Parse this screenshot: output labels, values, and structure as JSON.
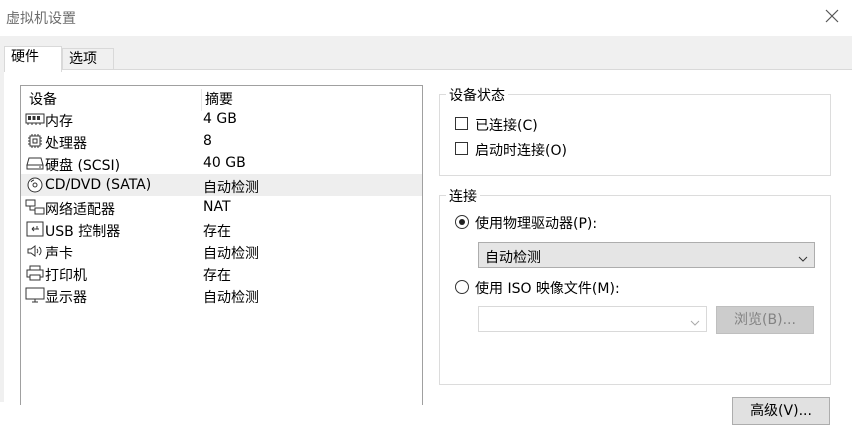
{
  "window": {
    "title": "虚拟机设置",
    "close_icon": "close-icon"
  },
  "tabs": [
    {
      "label": "硬件",
      "active": true
    },
    {
      "label": "选项",
      "active": false
    }
  ],
  "hardware_list": {
    "headers": {
      "device": "设备",
      "summary": "摘要"
    },
    "items": [
      {
        "name": "内存",
        "summary": "4 GB",
        "icon": "memory-icon",
        "selected": false
      },
      {
        "name": "处理器",
        "summary": "8",
        "icon": "processor-icon",
        "selected": false
      },
      {
        "name": "硬盘 (SCSI)",
        "summary": "40 GB",
        "icon": "hard-disk-icon",
        "selected": false
      },
      {
        "name": "CD/DVD (SATA)",
        "summary": "自动检测",
        "icon": "cd-dvd-icon",
        "selected": true
      },
      {
        "name": "网络适配器",
        "summary": "NAT",
        "icon": "network-adapter-icon",
        "selected": false
      },
      {
        "name": "USB 控制器",
        "summary": "存在",
        "icon": "usb-icon",
        "selected": false
      },
      {
        "name": "声卡",
        "summary": "自动检测",
        "icon": "speaker-icon",
        "selected": false
      },
      {
        "name": "打印机",
        "summary": "存在",
        "icon": "printer-icon",
        "selected": false
      },
      {
        "name": "显示器",
        "summary": "自动检测",
        "icon": "monitor-icon",
        "selected": false
      }
    ]
  },
  "device_status": {
    "title": "设备状态",
    "connected": {
      "label": "已连接(C)",
      "checked": false
    },
    "connect_at_power_on": {
      "label": "启动时连接(O)",
      "checked": false
    }
  },
  "connection": {
    "title": "连接",
    "use_physical": {
      "label": "使用物理驱动器(P):",
      "selected": true
    },
    "physical_drive_value": "自动检测",
    "use_iso": {
      "label": "使用 ISO 映像文件(M):",
      "selected": false
    },
    "iso_path_value": "",
    "browse_button": "浏览(B)..."
  },
  "advanced_button": "高级(V)..."
}
